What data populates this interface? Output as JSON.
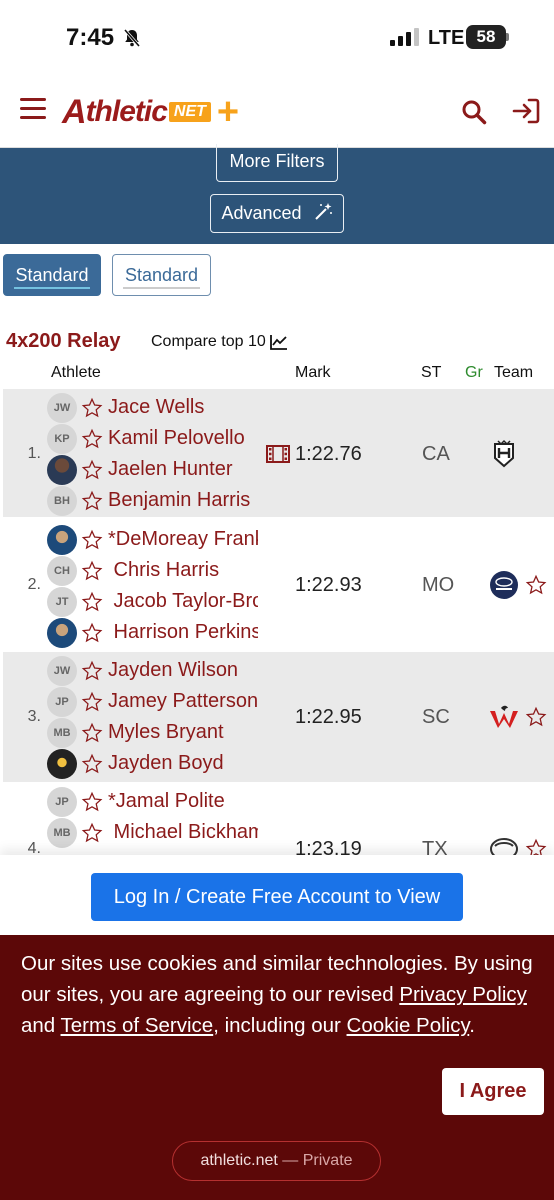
{
  "status": {
    "time": "7:45",
    "network": "LTE",
    "battery": "58"
  },
  "header": {
    "logo_a": "A",
    "logo_rest": "thletic",
    "logo_net": "NET",
    "logo_plus": "+"
  },
  "filters": {
    "more_label": "More Filters",
    "advanced_label": "Advanced"
  },
  "toggles": {
    "left": "Standard",
    "right": "Standard"
  },
  "event": {
    "title": "4x200 Relay",
    "compare_label": "Compare top 10"
  },
  "columns": {
    "athlete": "Athlete",
    "mark": "Mark",
    "st": "ST",
    "gr": "Gr",
    "team": "Team"
  },
  "results": [
    {
      "rank": "1.",
      "mark": "1:22.76",
      "state": "CA",
      "athletes": [
        {
          "initials": "JW",
          "name": "Jace Wells"
        },
        {
          "initials": "KP",
          "name": "Kamil Pelovello"
        },
        {
          "initials": "",
          "name": "Jaelen Hunter"
        },
        {
          "initials": "BH",
          "name": "Benjamin Harris"
        }
      ]
    },
    {
      "rank": "2.",
      "mark": "1:22.93",
      "state": "MO",
      "athletes": [
        {
          "initials": "",
          "name": "*DeMoreay Franklin"
        },
        {
          "initials": "CH",
          "name": " Chris Harris"
        },
        {
          "initials": "JT",
          "name": " Jacob Taylor-Brown"
        },
        {
          "initials": "",
          "name": " Harrison Perkins"
        }
      ]
    },
    {
      "rank": "3.",
      "mark": "1:22.95",
      "state": "SC",
      "athletes": [
        {
          "initials": "JW",
          "name": "Jayden Wilson"
        },
        {
          "initials": "JP",
          "name": "Jamey Patterson"
        },
        {
          "initials": "MB",
          "name": "Myles Bryant"
        },
        {
          "initials": "",
          "name": "Jayden Boyd"
        }
      ]
    },
    {
      "rank": "4.",
      "mark": "1:23.19",
      "state": "TX",
      "athletes": [
        {
          "initials": "JP",
          "name": "*Jamal Polite"
        },
        {
          "initials": "MB",
          "name": " Michael Bickham"
        }
      ]
    }
  ],
  "login": {
    "label": "Log In / Create Free Account to View"
  },
  "cookie": {
    "text_1": "Our sites use cookies and similar technologies. By using our sites, you are agreeing to our revised ",
    "privacy_link": "Privacy Policy",
    "text_2": " and ",
    "terms_link": "Terms of Service",
    "text_3": ", including our ",
    "cookie_link": "Cookie Policy",
    "text_4": ".",
    "agree_label": "I Agree"
  },
  "url_bar": {
    "domain": "athletic.net",
    "separator": " — ",
    "mode": "Private"
  },
  "colors": {
    "brand": "#8b1a1a",
    "accent": "#f7a21b",
    "filter_band": "#2d5479",
    "login_button": "#1a73e8",
    "cookie_bg": "#5c0808"
  }
}
